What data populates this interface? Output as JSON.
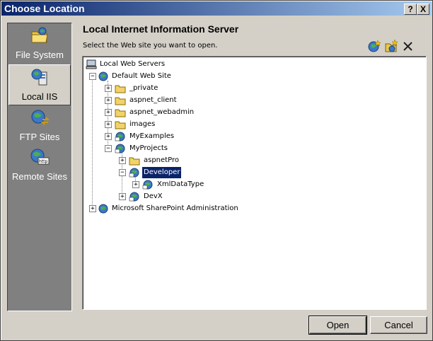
{
  "window": {
    "title": "Choose Location",
    "help_label": "?",
    "close_label": "X"
  },
  "sidebar": {
    "items": [
      {
        "label": "File System",
        "icon": "folder-globe-icon"
      },
      {
        "label": "Local IIS",
        "icon": "server-globe-icon"
      },
      {
        "label": "FTP Sites",
        "icon": "globe-arrows-icon"
      },
      {
        "label": "Remote Sites",
        "icon": "globe-http-icon"
      }
    ]
  },
  "main": {
    "heading": "Local Internet Information Server",
    "instruction": "Select the Web site you want to open."
  },
  "toolbar": {
    "new_web_app": "new-web-application-icon",
    "new_virtual_dir": "new-virtual-directory-icon",
    "delete": "delete-icon"
  },
  "tree": {
    "root": "Local Web Servers",
    "default_site": "Default Web Site",
    "private": "_private",
    "aspnet_client": "aspnet_client",
    "aspnet_webadmin": "aspnet_webadmin",
    "images": "images",
    "myexamples": "MyExamples",
    "myprojects": "MyProjects",
    "aspnetpro": "aspnetPro",
    "developer": "Developer",
    "xmldatatype": "XmlDataType",
    "devx": "DevX",
    "sharepoint": "Microsoft SharePoint Administration"
  },
  "buttons": {
    "open": "Open",
    "cancel": "Cancel"
  }
}
